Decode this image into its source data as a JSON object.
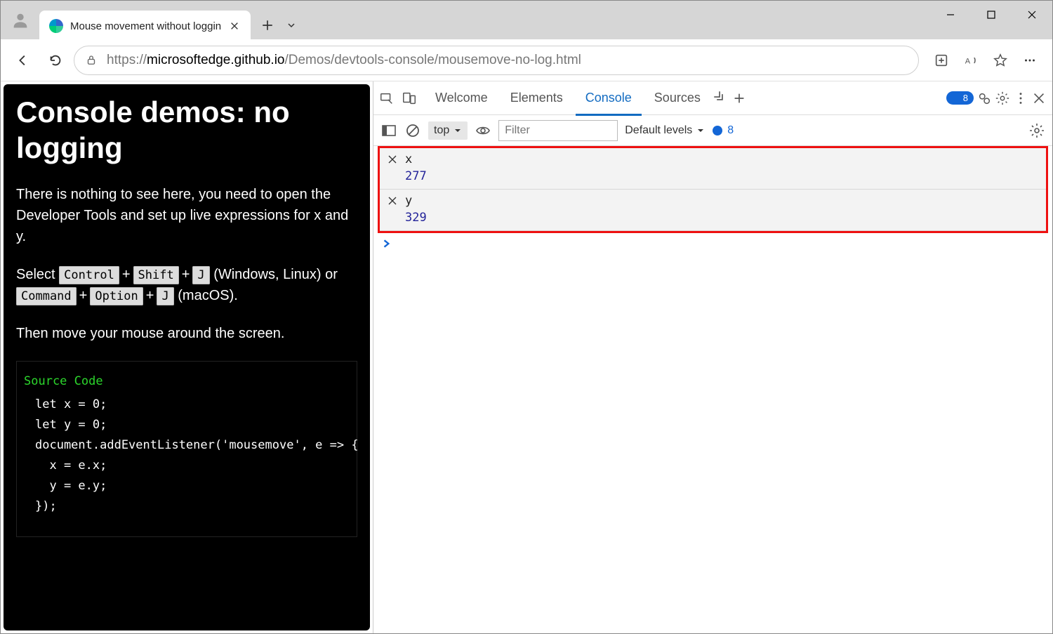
{
  "window": {
    "tab_title": "Mouse movement without loggin"
  },
  "toolbar": {
    "url_emph": "microsoftedge.github.io",
    "url_rest": "/Demos/devtools-console/mousemove-no-log.html",
    "url_scheme": "https://"
  },
  "page": {
    "heading": "Console demos: no logging",
    "p1": "There is nothing to see here, you need to open the Developer Tools and set up live expressions for x and y.",
    "p2_select": "Select ",
    "kbd_ctrl": "Control",
    "kbd_shift": "Shift",
    "kbd_j": "J",
    "p2_winlinux": " (Windows, Linux) or ",
    "kbd_cmd": "Command",
    "kbd_opt": "Option",
    "p2_macos": " (macOS).",
    "p3": "Then move your mouse around the screen.",
    "src_label": "Source Code",
    "code_lines": [
      "let x = 0;",
      "let y = 0;",
      "document.addEventListener('mousemove', e => {",
      "  x = e.x;",
      "  y = e.y;",
      "});"
    ]
  },
  "devtools": {
    "tabs": {
      "welcome": "Welcome",
      "elements": "Elements",
      "console": "Console",
      "sources": "Sources"
    },
    "issues_count": "8",
    "console_bar": {
      "context": "top",
      "filter_placeholder": "Filter",
      "levels": "Default levels",
      "issues_count": "8"
    },
    "live_expressions": [
      {
        "expr": "x",
        "value": "277"
      },
      {
        "expr": "y",
        "value": "329"
      }
    ]
  }
}
